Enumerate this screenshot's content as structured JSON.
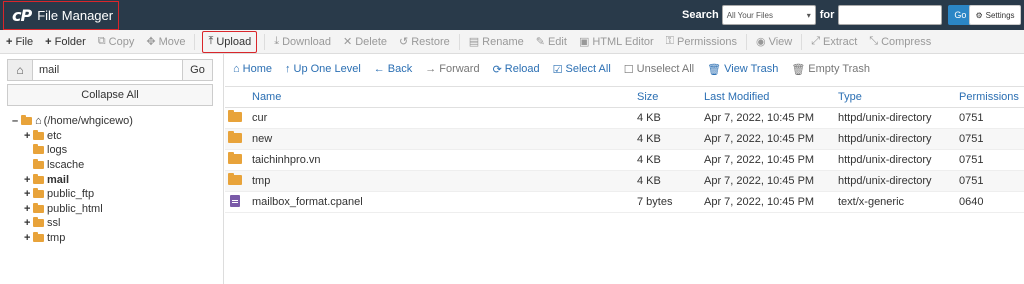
{
  "header": {
    "logo": "cP",
    "title": "File Manager",
    "search_label": "Search",
    "search_scope": "All Your Files",
    "for_label": "for",
    "search_value": "",
    "go_label": "Go",
    "settings_label": "Settings"
  },
  "toolbar": [
    {
      "name": "file",
      "label": "File",
      "icon": "+",
      "active": true
    },
    {
      "name": "folder",
      "label": "Folder",
      "icon": "+",
      "active": true
    },
    {
      "name": "copy",
      "label": "Copy",
      "icon": "⧉",
      "active": false
    },
    {
      "name": "move",
      "label": "Move",
      "icon": "✥",
      "active": false
    },
    {
      "name": "upload",
      "label": "Upload",
      "icon": "⤒",
      "active": true
    },
    {
      "name": "download",
      "label": "Download",
      "icon": "⤓",
      "active": false
    },
    {
      "name": "delete",
      "label": "Delete",
      "icon": "✕",
      "active": false
    },
    {
      "name": "restore",
      "label": "Restore",
      "icon": "↺",
      "active": false
    },
    {
      "name": "rename",
      "label": "Rename",
      "icon": "▤",
      "active": false
    },
    {
      "name": "edit",
      "label": "Edit",
      "icon": "✎",
      "active": false
    },
    {
      "name": "html-editor",
      "label": "HTML Editor",
      "icon": "▣",
      "active": false
    },
    {
      "name": "permissions",
      "label": "Permissions",
      "icon": "⚿",
      "active": false
    },
    {
      "name": "view",
      "label": "View",
      "icon": "◉",
      "active": false
    },
    {
      "name": "extract",
      "label": "Extract",
      "icon": "⤢",
      "active": false
    },
    {
      "name": "compress",
      "label": "Compress",
      "icon": "⤡",
      "active": false
    }
  ],
  "left": {
    "path_value": "mail",
    "go_label": "Go",
    "collapse_label": "Collapse All",
    "root_label": "(/home/whgicewo)",
    "tree": [
      {
        "label": "etc",
        "toggle": "+",
        "bold": false,
        "indent": 1
      },
      {
        "label": "logs",
        "toggle": "",
        "bold": false,
        "indent": 1
      },
      {
        "label": "lscache",
        "toggle": "",
        "bold": false,
        "indent": 1
      },
      {
        "label": "mail",
        "toggle": "+",
        "bold": true,
        "indent": 1
      },
      {
        "label": "public_ftp",
        "toggle": "+",
        "bold": false,
        "indent": 1
      },
      {
        "label": "public_html",
        "toggle": "+",
        "bold": false,
        "indent": 1
      },
      {
        "label": "ssl",
        "toggle": "+",
        "bold": false,
        "indent": 1
      },
      {
        "label": "tmp",
        "toggle": "+",
        "bold": false,
        "indent": 1
      }
    ]
  },
  "nav": {
    "home": "Home",
    "up": "Up One Level",
    "back": "Back",
    "forward": "Forward",
    "reload": "Reload",
    "select_all": "Select All",
    "unselect_all": "Unselect All",
    "view_trash": "View Trash",
    "empty_trash": "Empty Trash"
  },
  "table": {
    "headers": {
      "name": "Name",
      "size": "Size",
      "modified": "Last Modified",
      "type": "Type",
      "permissions": "Permissions"
    },
    "rows": [
      {
        "kind": "folder",
        "name": "cur",
        "size": "4 KB",
        "modified": "Apr 7, 2022, 10:45 PM",
        "type": "httpd/unix-directory",
        "perm": "0751"
      },
      {
        "kind": "folder",
        "name": "new",
        "size": "4 KB",
        "modified": "Apr 7, 2022, 10:45 PM",
        "type": "httpd/unix-directory",
        "perm": "0751"
      },
      {
        "kind": "folder",
        "name": "taichinhpro.vn",
        "size": "4 KB",
        "modified": "Apr 7, 2022, 10:45 PM",
        "type": "httpd/unix-directory",
        "perm": "0751"
      },
      {
        "kind": "folder",
        "name": "tmp",
        "size": "4 KB",
        "modified": "Apr 7, 2022, 10:45 PM",
        "type": "httpd/unix-directory",
        "perm": "0751"
      },
      {
        "kind": "file",
        "name": "mailbox_format.cpanel",
        "size": "7 bytes",
        "modified": "Apr 7, 2022, 10:45 PM",
        "type": "text/x-generic",
        "perm": "0640"
      }
    ]
  }
}
